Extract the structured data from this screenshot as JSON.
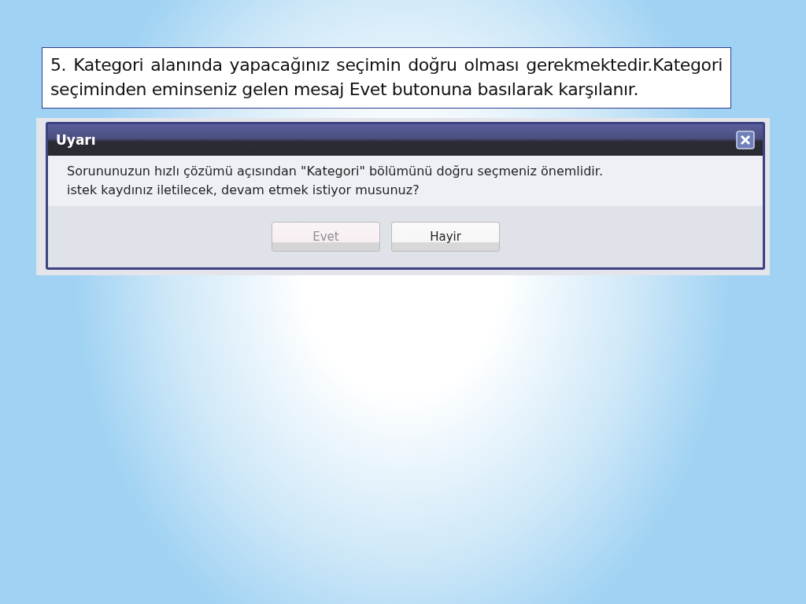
{
  "slide_text": "5. Kategori alanında yapacağınız seçimin doğru olması gerekmektedir.Kategori seçiminden eminseniz gelen mesaj Evet butonuna basılarak karşılanır.",
  "dialog": {
    "title": "Uyarı",
    "message_lines": [
      "Sorununuzun hızlı çözümü açısından \"Kategori\" bölümünü doğru seçmeniz önemlidir.",
      "istek kaydınız iletilecek, devam etmek istiyor musunuz?"
    ],
    "buttons": [
      {
        "label": "Evet",
        "focused": true
      },
      {
        "label": "Hayir",
        "focused": false
      }
    ]
  }
}
